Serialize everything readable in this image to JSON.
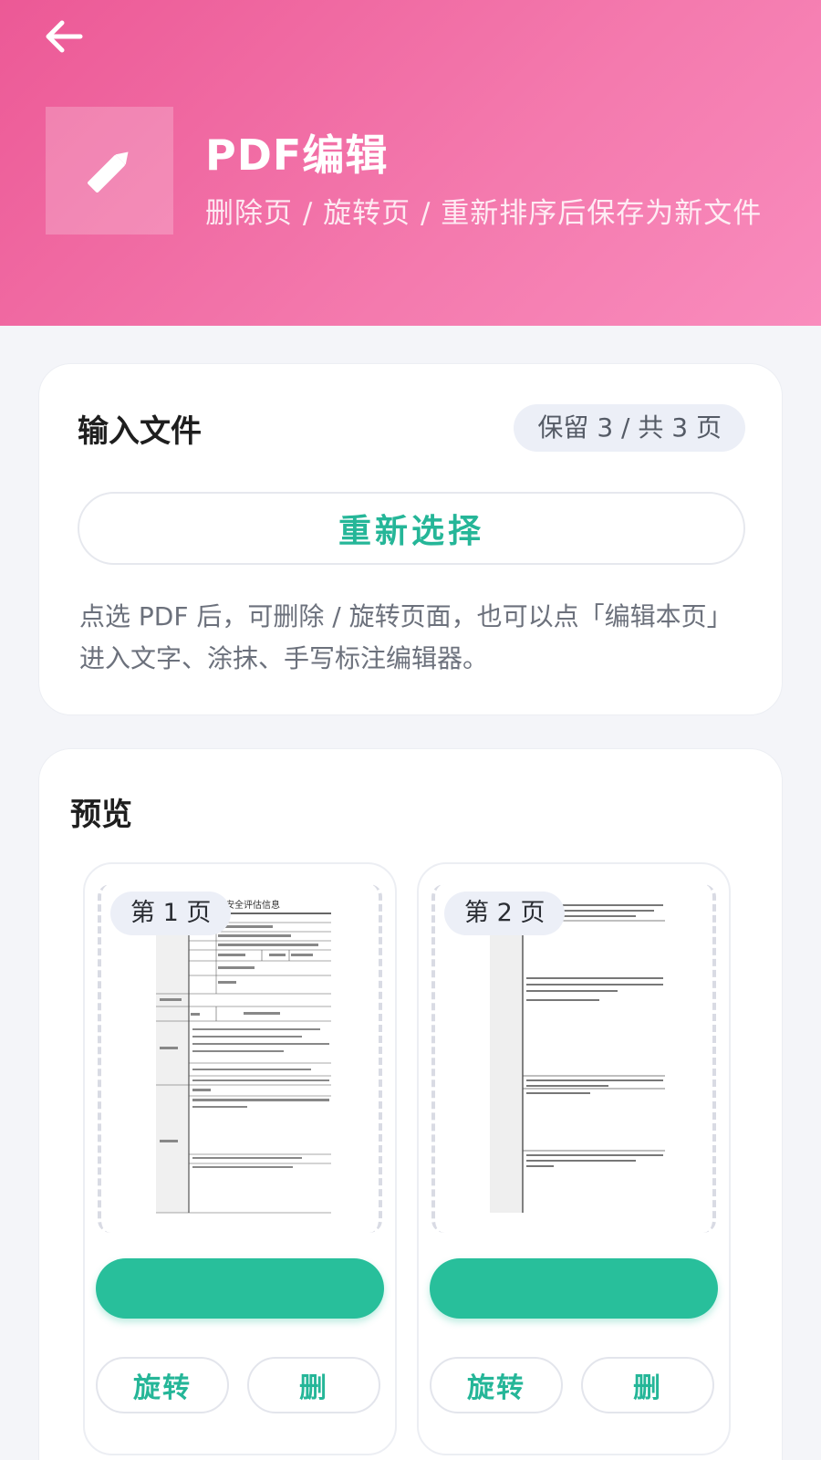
{
  "header": {
    "title": "PDF编辑",
    "subtitle": "删除页 / 旋转页 / 重新排序后保存为新文件",
    "back_icon": "arrow-left-icon",
    "logo_icon": "pencil-icon",
    "gradient_start": "#ec5996",
    "gradient_end": "#f98cbd"
  },
  "input_section": {
    "title": "输入文件",
    "page_count_badge": "保留 3 / 共 3 页",
    "reselect_label": "重新选择",
    "hint": "点选 PDF 后，可删除 / 旋转页面，也可以点「编辑本页」进入文字、涂抹、手写标注编辑器。"
  },
  "preview_section": {
    "title": "预览",
    "pages": [
      {
        "badge": "第 1 页",
        "doc_title": "安全评估信息",
        "rotate_label": "旋转",
        "delete_label": "删"
      },
      {
        "badge": "第 2 页",
        "rotate_label": "旋转",
        "delete_label": "删"
      }
    ]
  },
  "colors": {
    "accent": "#25b698",
    "button_fill": "#28bf9b",
    "background": "#f4f5f9"
  }
}
